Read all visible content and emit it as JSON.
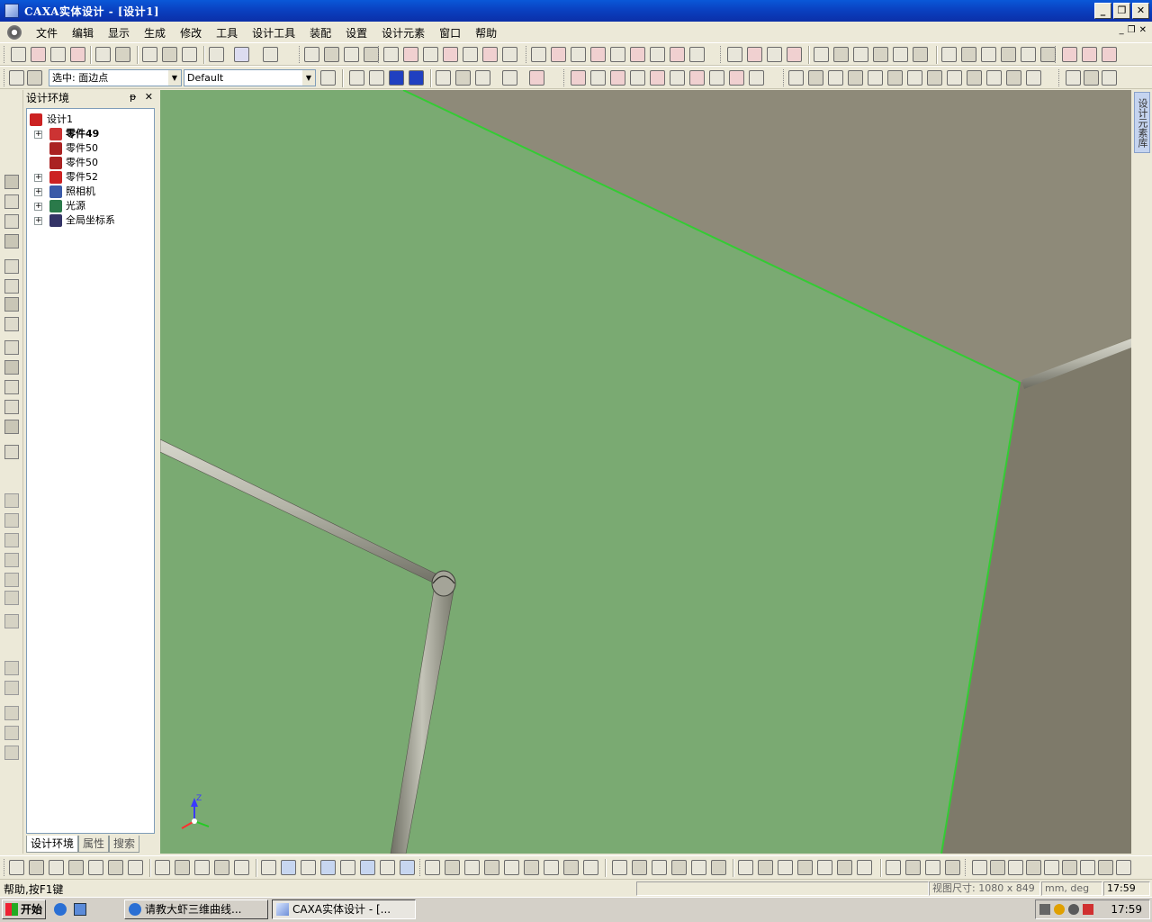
{
  "window": {
    "title": "CAXA实体设计 - [设计1]",
    "buttons": [
      "_",
      "❐",
      "✕"
    ]
  },
  "menu": {
    "items": [
      "文件",
      "编辑",
      "显示",
      "生成",
      "修改",
      "工具",
      "设计工具",
      "装配",
      "设置",
      "设计元素",
      "窗口",
      "帮助"
    ],
    "mdi_buttons": [
      "_",
      "❐",
      "✕"
    ]
  },
  "toolbar2": {
    "select_combo": "选中: 面边点",
    "style_combo": "Default"
  },
  "panel": {
    "title": "设计环境",
    "pin": "ᵽ",
    "close": "✕",
    "tree": [
      {
        "label": "设计1",
        "bold": false,
        "expander": false,
        "level": 0
      },
      {
        "label": "零件49",
        "bold": true,
        "expander": true,
        "level": 1
      },
      {
        "label": "零件50",
        "bold": false,
        "expander": false,
        "level": 1
      },
      {
        "label": "零件50",
        "bold": false,
        "expander": false,
        "level": 1
      },
      {
        "label": "零件52",
        "bold": false,
        "expander": true,
        "level": 1
      },
      {
        "label": "照相机",
        "bold": false,
        "expander": true,
        "level": 1
      },
      {
        "label": "光源",
        "bold": false,
        "expander": true,
        "level": 1
      },
      {
        "label": "全局坐标系",
        "bold": false,
        "expander": true,
        "level": 1
      }
    ],
    "tabs": [
      "设计环境",
      "属性",
      "搜索"
    ]
  },
  "right_tab": "设计元素库",
  "viewport": {
    "axis_label": "Z",
    "colors": {
      "background": "#86826f",
      "face": "#7aaa72",
      "edge": "#33cc33",
      "wall": "#8e8a79",
      "pipe": "#a9a99d"
    }
  },
  "status": {
    "message": "帮助,按F1键",
    "view_size": "视图尺寸: 1080 x 849",
    "units": "mm, deg",
    "time": "17:59"
  },
  "taskbar": {
    "start": "开始",
    "tasks": [
      "请教大虾三维曲线...",
      "CAXA实体设计 - [..."
    ],
    "clock": "17:59"
  }
}
